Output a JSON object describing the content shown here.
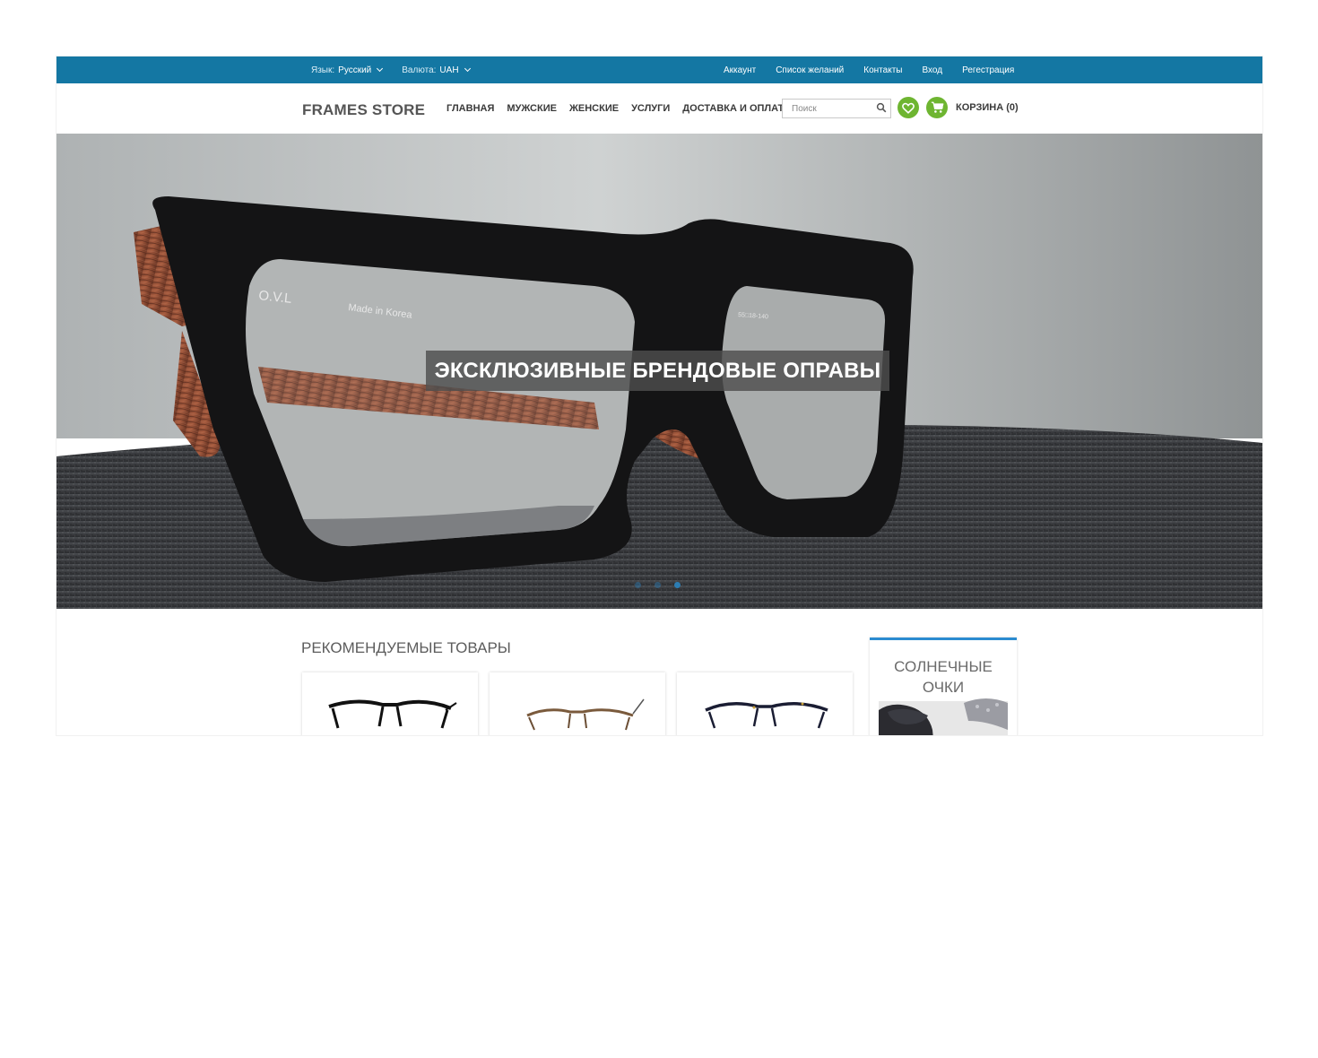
{
  "topbar": {
    "language_label": "Язык:",
    "language_value": "Русский",
    "currency_label": "Валюта:",
    "currency_value": "UAH",
    "links": [
      "Аккаунт",
      "Список желаний",
      "Контакты",
      "Вход",
      "Регестрация"
    ]
  },
  "header": {
    "logo": "FRAMES STORE",
    "nav": [
      "ГЛАВНАЯ",
      "МУЖСКИЕ",
      "ЖЕНСКИЕ",
      "УСЛУГИ",
      "ДОСТАВКА И ОПЛАТА"
    ],
    "search_placeholder": "Поиск",
    "cart_label": "КОРЗИНА (0)"
  },
  "hero": {
    "caption": "ЭКСКЛЮЗИВНЫЕ БРЕНДОВЫЕ ОПРАВЫ",
    "temple_text_1": "O.V.L",
    "temple_text_2": "Made in Korea",
    "temple_text_3": "55□18-140",
    "slides_count": 3,
    "active_slide": 3
  },
  "featured": {
    "title": "РЕКОМЕНДУЕМЫЕ ТОВАРЫ"
  },
  "sidebar_banner": {
    "title_line1": "СОЛНЕЧНЫЕ",
    "title_line2": "ОЧКИ"
  },
  "colors": {
    "topbar": "#1477a3",
    "accent_green": "#6eb531",
    "banner_border": "#2b8bd0"
  }
}
